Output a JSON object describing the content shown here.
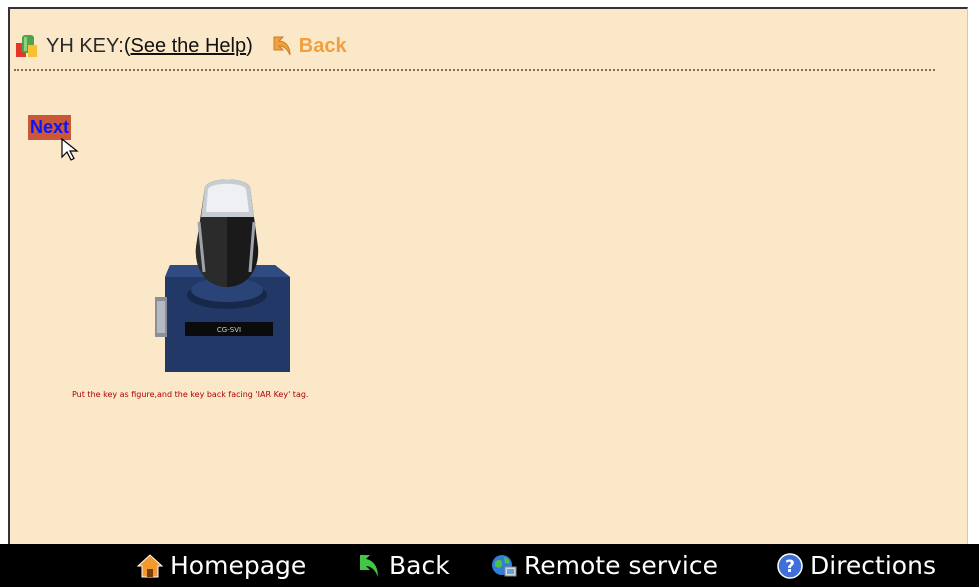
{
  "header": {
    "app_label": "YH KEY:",
    "help_link": "See the Help",
    "open_paren": "(",
    "close_paren": ")",
    "back_label": "Back"
  },
  "main": {
    "next_label": "Next",
    "instruction": "Put the key as figure,and the key back facing 'IAR Key' tag.",
    "device_label": "CG-SVI"
  },
  "bottom_bar": {
    "items": [
      {
        "label": "Homepage",
        "icon": "home-icon"
      },
      {
        "label": "Back",
        "icon": "back-arrow-icon"
      },
      {
        "label": "Remote service",
        "icon": "remote-service-icon"
      },
      {
        "label": "Directions",
        "icon": "help-circle-icon"
      }
    ]
  },
  "colors": {
    "page_bg": "#fbe8c8",
    "accent_orange": "#f0a040",
    "next_bg": "#c9573a",
    "next_text": "#0a14ff",
    "instruction_red": "#b00000",
    "bottom_bar_bg": "#000000"
  }
}
